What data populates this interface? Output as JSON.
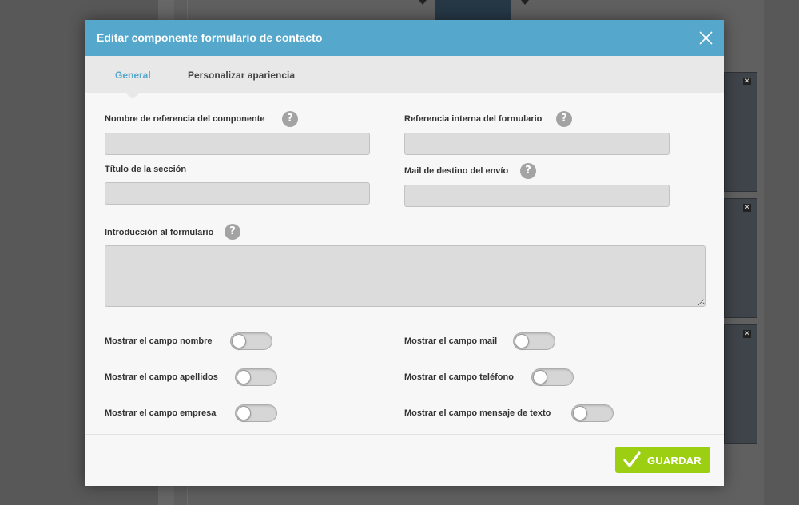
{
  "modal": {
    "title": "Editar componente formulario de contacto"
  },
  "tabs": [
    {
      "label": "General",
      "active": true
    },
    {
      "label": "Personalizar apariencia",
      "active": false
    }
  ],
  "fields": {
    "nombre_referencia": {
      "label": "Nombre de referencia del componente",
      "value": ""
    },
    "referencia_interna": {
      "label": "Referencia interna del formulario",
      "value": ""
    },
    "titulo_seccion": {
      "label": "Título de la sección",
      "value": ""
    },
    "mail_destino": {
      "label": "Mail de destino del envío",
      "value": ""
    },
    "introduccion": {
      "label": "Introducción al formulario",
      "value": ""
    }
  },
  "toggles": [
    {
      "label": "Mostrar el campo nombre",
      "on": false
    },
    {
      "label": "Mostrar el campo mail",
      "on": false
    },
    {
      "label": "Mostrar el campo apellidos",
      "on": false
    },
    {
      "label": "Mostrar el campo teléfono",
      "on": false
    },
    {
      "label": "Mostrar el campo empresa",
      "on": false
    },
    {
      "label": "Mostrar el campo mensaje de texto",
      "on": false
    }
  ],
  "help_glyph": "?",
  "save_button": {
    "label": "GUARDAR"
  },
  "colors": {
    "header": "#55a7cc",
    "active_tab": "#55a7cc",
    "save": "#9ccf12"
  },
  "background": {
    "close_glyph": "✕"
  }
}
